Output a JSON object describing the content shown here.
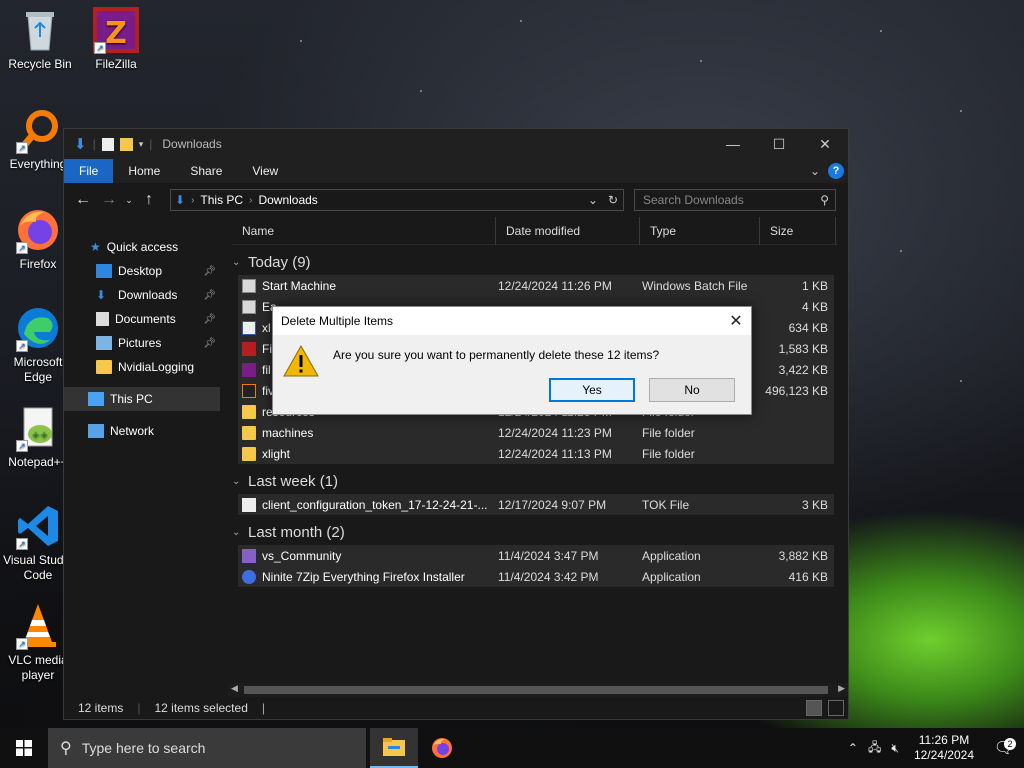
{
  "desktop": {
    "icons": [
      {
        "label": "Recycle Bin"
      },
      {
        "label": "FileZilla"
      },
      {
        "label": "Everything"
      },
      {
        "label": "Firefox"
      },
      {
        "label": "Microsoft Edge"
      },
      {
        "label": "Notepad++"
      },
      {
        "label": "Visual Studio Code"
      },
      {
        "label": "VLC media player"
      }
    ]
  },
  "window": {
    "title": "Downloads",
    "ribbon_tabs": [
      "File",
      "Home",
      "Share",
      "View"
    ],
    "breadcrumb": [
      "This PC",
      "Downloads"
    ],
    "search_placeholder": "Search Downloads",
    "columns": [
      "Name",
      "Date modified",
      "Type",
      "Size"
    ],
    "nav": {
      "quick_access": "Quick access",
      "items": [
        "Desktop",
        "Downloads",
        "Documents",
        "Pictures",
        "NvidiaLogging"
      ],
      "this_pc": "This PC",
      "network": "Network"
    },
    "groups": [
      {
        "label": "Today (9)"
      },
      {
        "label": "Last week (1)"
      },
      {
        "label": "Last month (2)"
      }
    ],
    "today_rows": [
      {
        "name": "Start Machine",
        "date": "12/24/2024 11:26 PM",
        "type": "Windows Batch File",
        "size": "1 KB"
      },
      {
        "name": "Ea",
        "date": "",
        "type": "",
        "size": "4 KB"
      },
      {
        "name": "xl",
        "date": "",
        "type": "",
        "size": "634 KB"
      },
      {
        "name": "Fi",
        "date": "",
        "type": "",
        "size": "1,583 KB"
      },
      {
        "name": "fil",
        "date": "",
        "type": "",
        "size": "3,422 KB"
      },
      {
        "name": "fiv",
        "date": "",
        "type": "",
        "size": "496,123 KB"
      },
      {
        "name": "resources",
        "date": "12/24/2024 11:25 PM",
        "type": "File folder",
        "size": ""
      },
      {
        "name": "machines",
        "date": "12/24/2024 11:23 PM",
        "type": "File folder",
        "size": ""
      },
      {
        "name": "xlight",
        "date": "12/24/2024 11:13 PM",
        "type": "File folder",
        "size": ""
      }
    ],
    "lastweek_rows": [
      {
        "name": "client_configuration_token_17-12-24-21-...",
        "date": "12/17/2024 9:07 PM",
        "type": "TOK File",
        "size": "3 KB"
      }
    ],
    "lastmonth_rows": [
      {
        "name": "vs_Community",
        "date": "11/4/2024 3:47 PM",
        "type": "Application",
        "size": "3,882 KB"
      },
      {
        "name": "Ninite 7Zip Everything Firefox Installer",
        "date": "11/4/2024 3:42 PM",
        "type": "Application",
        "size": "416 KB"
      }
    ],
    "status": {
      "count": "12 items",
      "selected": "12 items selected"
    }
  },
  "dialog": {
    "title": "Delete Multiple Items",
    "message": "Are you sure you want to permanently delete these 12 items?",
    "yes": "Yes",
    "no": "No"
  },
  "taskbar": {
    "search_placeholder": "Type here to search",
    "time": "11:26 PM",
    "date": "12/24/2024",
    "notification_count": "2"
  },
  "colors": {
    "accent": "#1a66c5",
    "folder": "#f5c84c",
    "warning": "#f2b705"
  }
}
